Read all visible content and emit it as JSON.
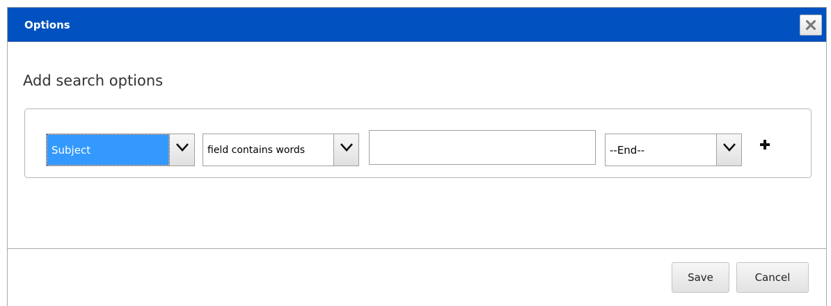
{
  "dialog": {
    "title": "Options",
    "close_icon": "close-icon"
  },
  "main": {
    "heading": "Add search options",
    "criteria": {
      "field_select": {
        "value": "Subject",
        "icon": "chevron-down-icon"
      },
      "operator_select": {
        "value": "field contains words",
        "icon": "chevron-down-icon"
      },
      "search_text": {
        "value": "",
        "placeholder": ""
      },
      "end_select": {
        "value": "--End--",
        "icon": "chevron-down-icon"
      },
      "add_icon": "plus-icon"
    }
  },
  "footer": {
    "save_label": "Save",
    "cancel_label": "Cancel"
  },
  "colors": {
    "titlebar": "#0152c0",
    "selected_option": "#3399ff"
  }
}
